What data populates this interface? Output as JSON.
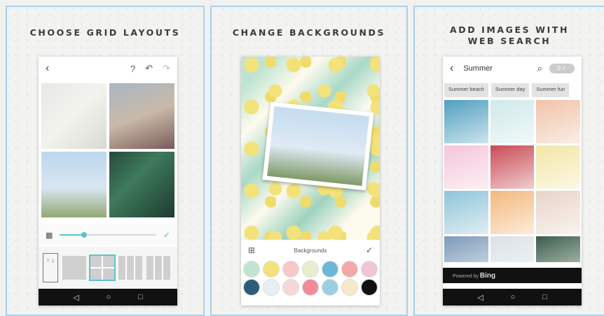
{
  "panels": [
    {
      "caption": "CHOOSE GRID LAYOUTS",
      "topbar": {
        "back_icon": "‹",
        "help_icon": "?",
        "undo_icon": "↶",
        "redo_icon": "↷"
      },
      "slider_value": 0.25,
      "layout_scroll": "↑ ↓"
    },
    {
      "caption": "CHANGE BACKGROUNDS",
      "toolbar_label": "Backgrounds",
      "swatch_colors": [
        "#bfe5d2",
        "#f3e27a",
        "#f7c8c8",
        "#e7eecf",
        "#6bb7d8",
        "#f4a9a8",
        "#efc6d6",
        "#2b5d7a",
        "#e9eef3",
        "#f5d7d7",
        "#f28a99",
        "#99cfe0",
        "#f4e9c9",
        "#111111"
      ]
    },
    {
      "caption_line1": "ADD IMAGES WITH",
      "caption_line2": "WEB SEARCH",
      "search_title": "Summer",
      "toggle_label": "0 ✓",
      "chips": [
        "Summer beach",
        "Summer day",
        "Summer fun"
      ],
      "image_colors": [
        "#4f9fc0",
        "#cfe9ea",
        "#f0c3a8",
        "#f5c6d8",
        "#c94b55",
        "#f3e6a6",
        "#8fc4d8",
        "#f4b97e",
        "#e9d4c8",
        "#7d9bb8",
        "#dbe1e6",
        "#3b5d4b"
      ],
      "powered_by": "Powered by",
      "bing": "Bing"
    }
  ],
  "navbar": {
    "back": "◁",
    "home": "○",
    "recent": "□"
  }
}
